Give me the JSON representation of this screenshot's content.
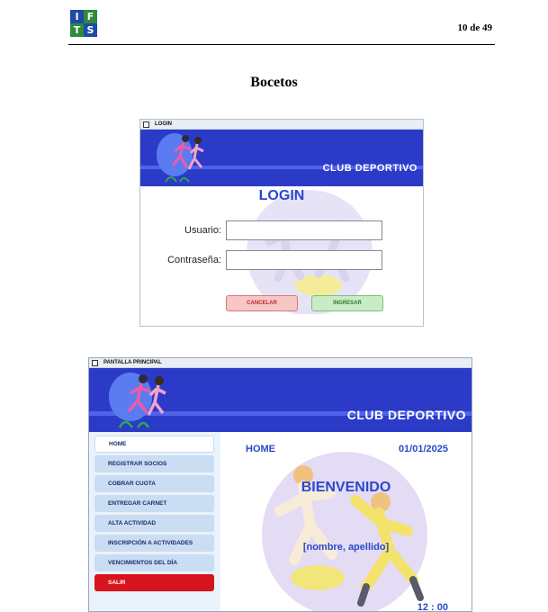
{
  "header": {
    "logo_letters": [
      "I",
      "F",
      "T",
      "S"
    ],
    "logo_colors": [
      "#1e4aa8",
      "#2e8b3a",
      "#2e8b3a",
      "#1e4aa8"
    ],
    "page_number": "10 de 49"
  },
  "doc_title": "Bocetos",
  "login_window": {
    "title": "LOGIN",
    "banner_title": "CLUB DEPORTIVO",
    "heading": "LOGIN",
    "user_label": "Usuario:",
    "user_value": "",
    "password_label": "Contraseña:",
    "password_value": "",
    "cancel_label": "CANCELAR",
    "submit_label": "INGRESAR"
  },
  "main_window": {
    "title": "PANTALLA PRINCIPAL",
    "banner_title": "CLUB DEPORTIVO",
    "menu": [
      {
        "label": "HOME",
        "state": "selected"
      },
      {
        "label": "REGISTRAR SOCIOS",
        "state": "normal"
      },
      {
        "label": "COBRAR CUOTA",
        "state": "normal"
      },
      {
        "label": "ENTREGAR CARNET",
        "state": "normal"
      },
      {
        "label": "ALTA ACTIVIDAD",
        "state": "normal"
      },
      {
        "label": "INSCRIPCIÓN A ACTIVIDADES",
        "state": "normal"
      },
      {
        "label": "VENCIMIENTOS DEL DÍA",
        "state": "normal"
      },
      {
        "label": "SALIR",
        "state": "danger"
      }
    ],
    "section_title": "HOME",
    "date": "01/01/2025",
    "welcome": "BIENVENIDO",
    "user_name": "[nombre, apellido]",
    "time": "12 : 00"
  },
  "colors": {
    "banner": "#2b3bc8",
    "accent_text": "#2a49c9",
    "exit_button": "#d7141d",
    "cancel_bg": "#f7c6c6",
    "submit_bg": "#c9ecc6"
  }
}
